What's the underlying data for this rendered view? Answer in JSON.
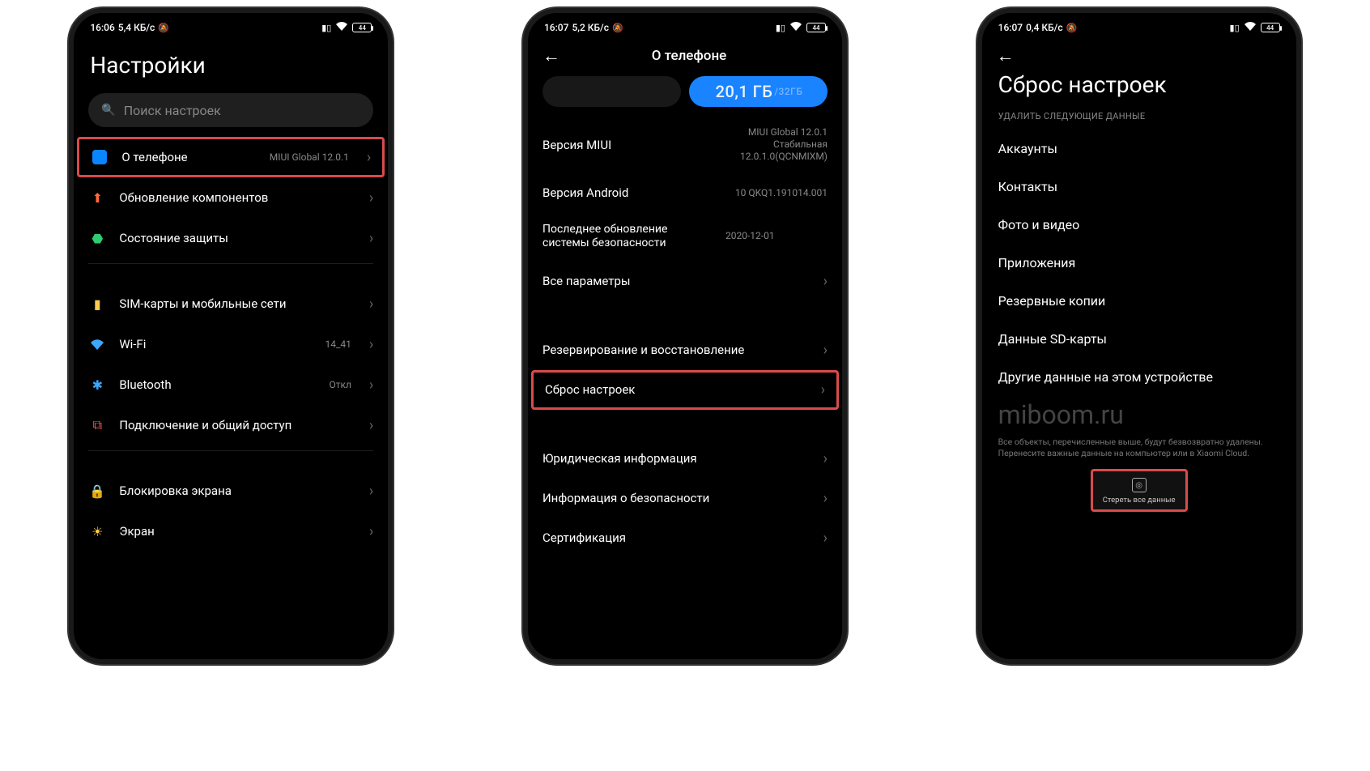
{
  "phone1": {
    "status": {
      "time": "16:06",
      "speed": "5,4 КБ/с",
      "battery": "44"
    },
    "title": "Настройки",
    "search_placeholder": "Поиск настроек",
    "rows": {
      "about": {
        "label": "О телефоне",
        "value": "MIUI Global 12.0.1"
      },
      "update": {
        "label": "Обновление компонентов"
      },
      "security": {
        "label": "Состояние защиты"
      },
      "sim": {
        "label": "SIM-карты и мобильные сети"
      },
      "wifi": {
        "label": "Wi-Fi",
        "value": "14_41"
      },
      "bt": {
        "label": "Bluetooth",
        "value": "Откл"
      },
      "share": {
        "label": "Подключение и общий доступ"
      },
      "lock": {
        "label": "Блокировка экрана"
      },
      "display": {
        "label": "Экран"
      }
    }
  },
  "phone2": {
    "status": {
      "time": "16:07",
      "speed": "5,2 КБ/с",
      "battery": "44"
    },
    "title": "О телефоне",
    "storage": {
      "used": "20,1 ГБ",
      "total": "/32ГБ"
    },
    "rows": {
      "miui": {
        "label": "Версия MIUI",
        "value": "MIUI Global 12.0.1\nСтабильная\n12.0.1.0(QCNMIXM)"
      },
      "android": {
        "label": "Версия Android",
        "value": "10 QKQ1.191014.001"
      },
      "patch": {
        "label": "Последнее обновление системы безопасности",
        "value": "2020-12-01"
      },
      "all": {
        "label": "Все параметры"
      },
      "backup": {
        "label": "Резервирование и восстановление"
      },
      "reset": {
        "label": "Сброс настроек"
      },
      "legal": {
        "label": "Юридическая информация"
      },
      "safety": {
        "label": "Информация о безопасности"
      },
      "cert": {
        "label": "Сертификация"
      }
    }
  },
  "phone3": {
    "status": {
      "time": "16:07",
      "speed": "0,4 КБ/с",
      "battery": "44"
    },
    "title": "Сброс настроек",
    "section": "УДАЛИТЬ СЛЕДУЮЩИЕ ДАННЫЕ",
    "items": {
      "accounts": "Аккаунты",
      "contacts": "Контакты",
      "media": "Фото и видео",
      "apps": "Приложения",
      "backups": "Резервные копии",
      "sd": "Данные SD-карты",
      "other": "Другие данные на этом устройстве"
    },
    "watermark": "miboom.ru",
    "note": "Все объекты, перечисленные выше, будут безвозвратно удалены. Перенесите важные данные на компьютер или в Xiaomi Cloud.",
    "erase": "Стереть все данные"
  }
}
